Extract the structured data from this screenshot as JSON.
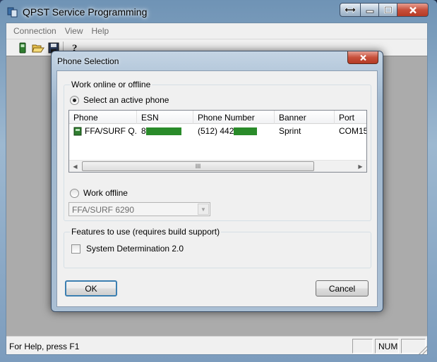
{
  "app": {
    "title": "QPST Service Programming",
    "menu": [
      "Connection",
      "View",
      "Help"
    ],
    "toolbar": [
      "phone-icon",
      "open-folder-icon",
      "save-icon",
      "help-icon"
    ],
    "status": {
      "help_text": "For Help, press F1",
      "num": "NUM"
    }
  },
  "dialog": {
    "title": "Phone Selection",
    "work_group": "Work online or offline",
    "select_active": "Select an active phone",
    "list": {
      "columns": [
        "Phone",
        "ESN",
        "Phone Number",
        "Banner",
        "Port"
      ],
      "rows": [
        {
          "phone": "FFA/SURF Q...",
          "esn": "8",
          "phone_number": "(512) 442",
          "banner": "Sprint",
          "port": "COM15"
        }
      ],
      "scroll_glyph": "III"
    },
    "work_offline": "Work offline",
    "offline_combo": "FFA/SURF 6290",
    "features_group": "Features to use (requires build support)",
    "system_determination": "System Determination 2.0",
    "ok": "OK",
    "cancel": "Cancel"
  },
  "colors": {
    "redaction": "#2a8b2a",
    "title_gradient": "#9db8d0"
  }
}
